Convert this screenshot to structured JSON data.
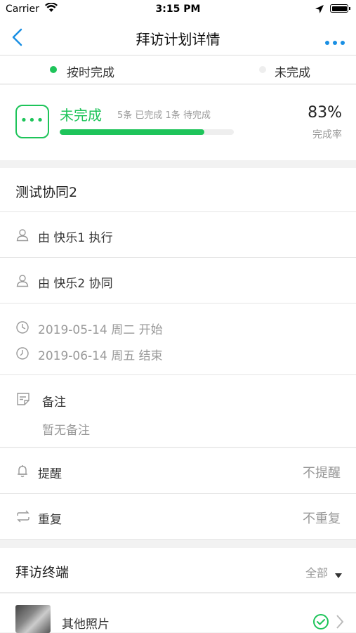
{
  "status_bar": {
    "carrier": "Carrier",
    "time": "3:15 PM"
  },
  "nav": {
    "title": "拜访计划详情"
  },
  "legend": {
    "on_time": {
      "label": "按时完成",
      "color": "#1ec45a"
    },
    "incomplete": {
      "label": "未完成",
      "color": "#eeeeee"
    }
  },
  "summary": {
    "status": "未完成",
    "counts": "5条 已完成 1条 待完成",
    "percent": "83%",
    "percent_value": 0.83,
    "percent_label": "完成率",
    "icon_glyph": "•••"
  },
  "plan": {
    "title": "测试协同2",
    "executor": "由 快乐1 执行",
    "collaborator": "由 快乐2 协同",
    "start": "2019-05-14 周二 开始",
    "end": "2019-06-14 周五 结束",
    "notes_label": "备注",
    "notes_value": "暂无备注",
    "reminder_label": "提醒",
    "reminder_value": "不提醒",
    "repeat_label": "重复",
    "repeat_value": "不重复"
  },
  "terminals": {
    "title": "拜访终端",
    "filter": "全部",
    "items": [
      {
        "label": "其他照片"
      }
    ]
  },
  "colors": {
    "accent": "#1ec45a",
    "nav_blue": "#1a8fe3"
  }
}
